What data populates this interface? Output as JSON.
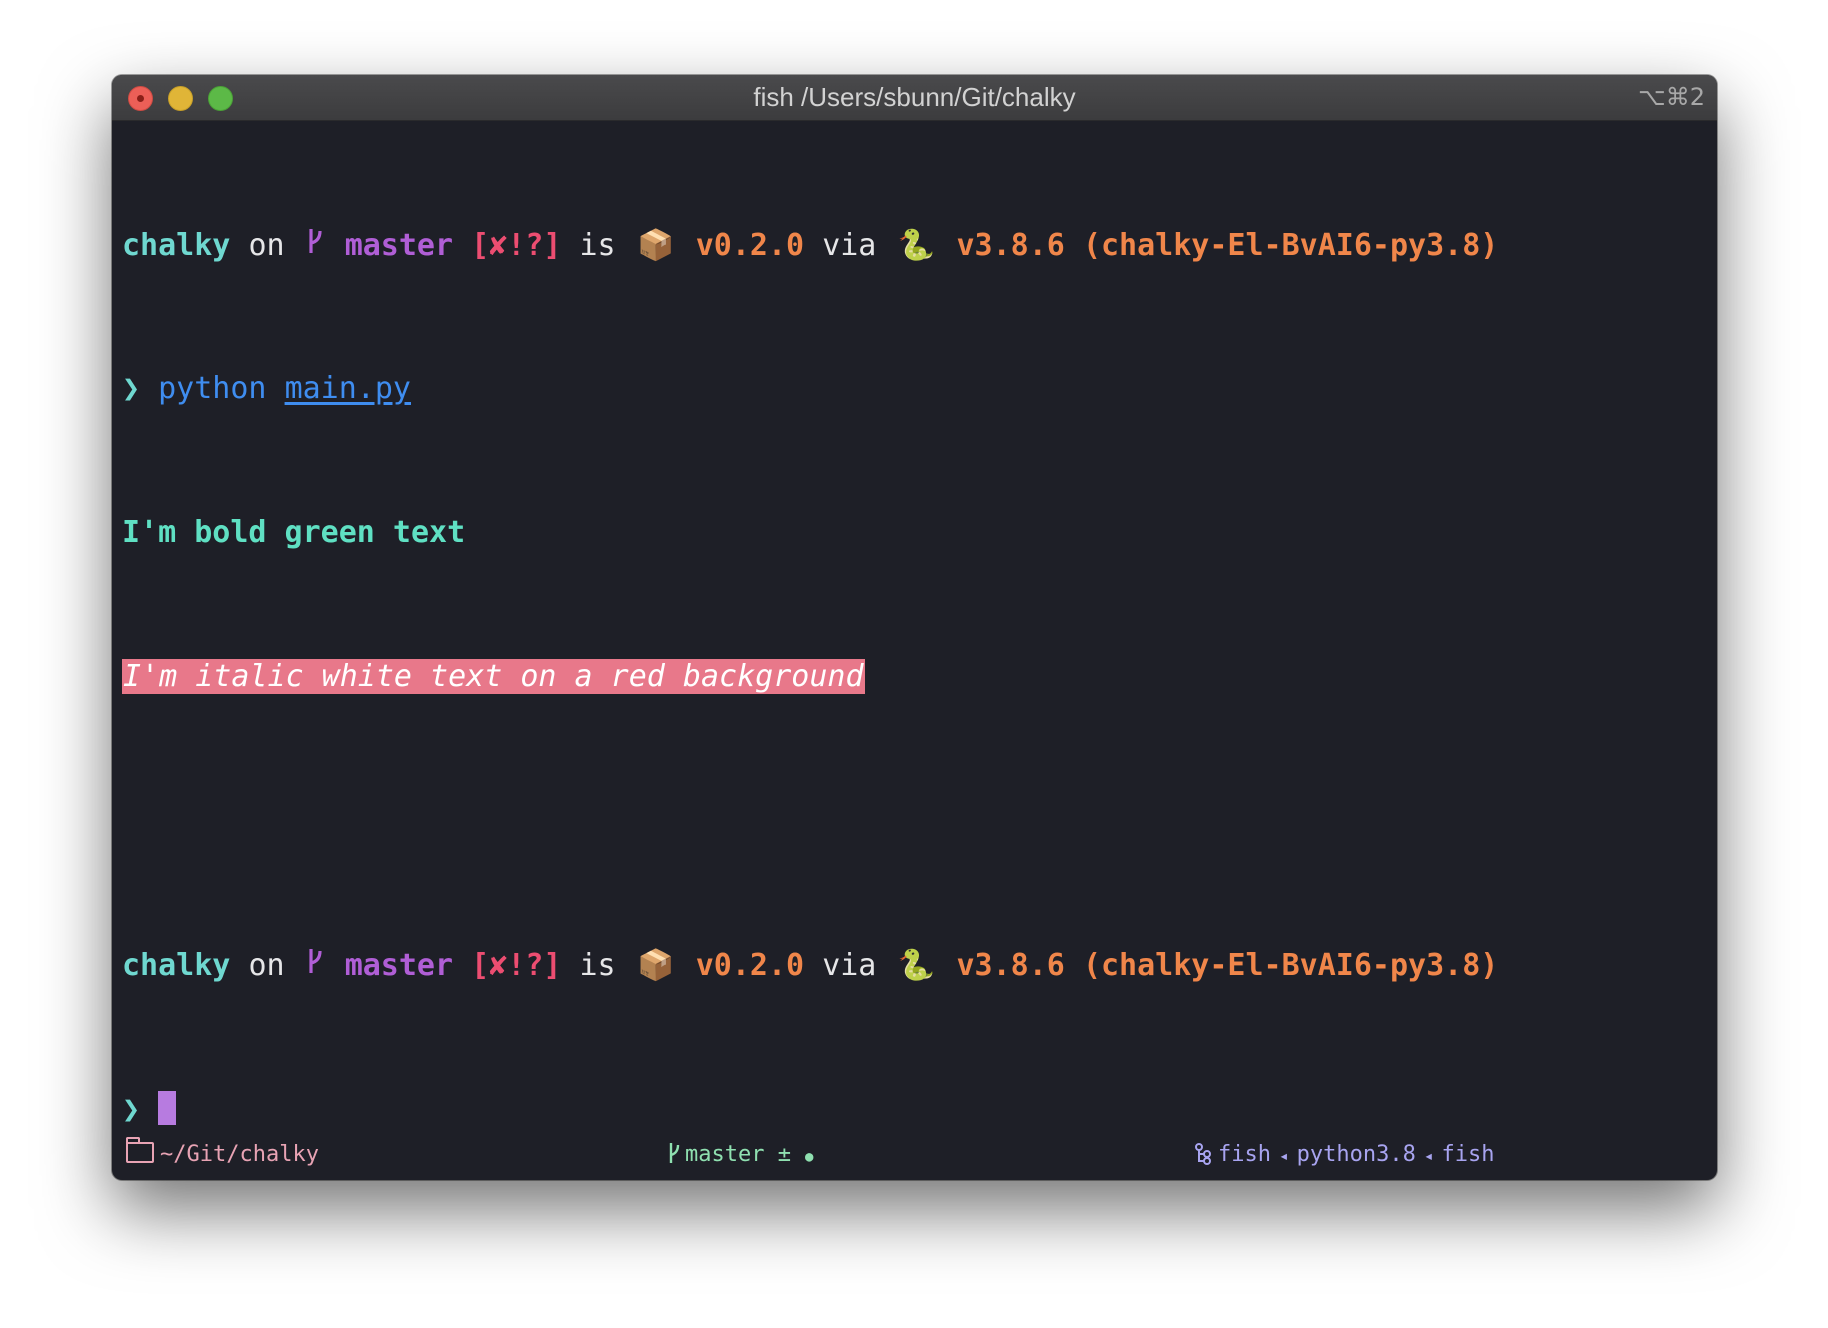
{
  "window": {
    "title": "fish /Users/sbunn/Git/chalky",
    "shortcut": "⌥⌘2"
  },
  "prompt": {
    "dir": "chalky",
    "on": "on",
    "branch_glyph": "",
    "branch": "master",
    "git_status": "[✘!?]",
    "is": "is",
    "package_emoji": "📦",
    "version": "v0.2.0",
    "via": "via",
    "python_emoji": "🐍",
    "python_version": "v3.8.6",
    "venv": "(chalky-El-BvAI6-py3.8)"
  },
  "command": {
    "arrow": "❯",
    "cmd": "python",
    "arg": "main.py"
  },
  "output": {
    "line1": "I'm bold green text",
    "line2": "I'm italic white text on a red background"
  },
  "statusbar": {
    "path": "~/Git/chalky",
    "branch_glyph": "",
    "branch": "master",
    "dirty": "±",
    "dot": "●",
    "tree_glyph": "⚲",
    "proc1": "fish",
    "sep": "◂",
    "proc2": "python3.8",
    "proc3": "fish"
  },
  "colors": {
    "background": "#1e1f27",
    "cyan": "#6fd8d0",
    "purple": "#b05ed6",
    "red": "#ec4d71",
    "orange": "#f0864a",
    "blue": "#3f8df0",
    "green": "#5fe0c3",
    "highlight_bg": "#e8788a",
    "cursor": "#b77be0"
  }
}
